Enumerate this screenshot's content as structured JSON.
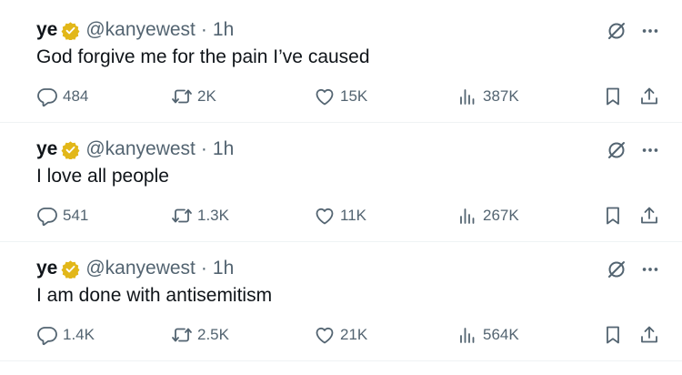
{
  "tweets": [
    {
      "name": "ye",
      "handle": "@kanyewest",
      "separator": "·",
      "time": "1h",
      "text": "God forgive me for the pain I’ve caused",
      "replies": "484",
      "retweets": "2K",
      "likes": "15K",
      "views": "387K"
    },
    {
      "name": "ye",
      "handle": "@kanyewest",
      "separator": "·",
      "time": "1h",
      "text": "I love all people",
      "replies": "541",
      "retweets": "1.3K",
      "likes": "11K",
      "views": "267K"
    },
    {
      "name": "ye",
      "handle": "@kanyewest",
      "separator": "·",
      "time": "1h",
      "text": "I am done with antisemitism",
      "replies": "1.4K",
      "retweets": "2.5K",
      "likes": "21K",
      "views": "564K"
    }
  ],
  "icons": {
    "verified": "verified-badge-icon",
    "grok": "grok-icon",
    "more": "more-icon",
    "reply": "reply-icon",
    "retweet": "retweet-icon",
    "like": "heart-icon",
    "views": "views-icon",
    "bookmark": "bookmark-icon",
    "share": "share-icon"
  },
  "colors": {
    "text": "#0f1419",
    "secondary": "#536471",
    "verified_gold": "#e2b719",
    "divider": "#eff3f4"
  }
}
